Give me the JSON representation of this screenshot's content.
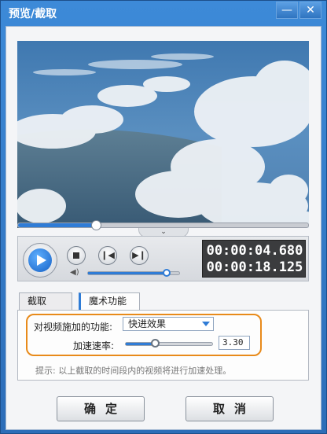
{
  "window": {
    "title": "预览/截取",
    "min_glyph": "—",
    "close_glyph": "✕"
  },
  "player": {
    "seek_progress": 0.26,
    "volume_level": 0.9,
    "current_time": "00:00:04.680",
    "total_time": "00:00:18.125",
    "seek_toggle_glyph": "⌄"
  },
  "tabs": [
    {
      "label": "截取"
    },
    {
      "label": "魔术功能"
    }
  ],
  "magic": {
    "function_label": "对视频施加的功能:",
    "function_value": "快进效果",
    "speed_label": "加速速率:",
    "speed_value": "3.30",
    "speed_level": 0.32,
    "hint": "提示: 以上截取的时间段内的视频将进行加速处理。"
  },
  "buttons": {
    "ok": "确定",
    "cancel": "取消"
  },
  "colors": {
    "accent": "#2f7cd6",
    "highlight": "#e88a1a"
  }
}
